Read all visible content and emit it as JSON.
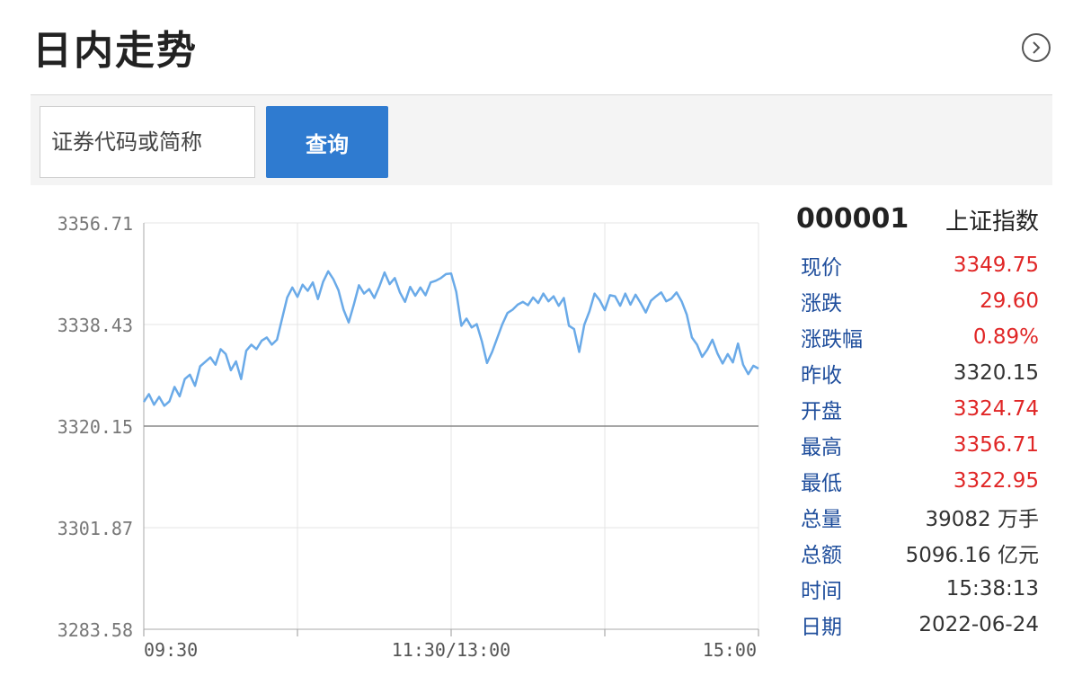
{
  "header": {
    "title": "日内走势",
    "more_icon": "chevron-right-circle-icon"
  },
  "search": {
    "placeholder": "证券代码或简称",
    "button_label": "查询"
  },
  "chart_data": {
    "type": "line",
    "y_ticks": [
      "3356.71",
      "3338.43",
      "3320.15",
      "3301.87",
      "3283.58"
    ],
    "ylim": [
      3283.58,
      3356.71
    ],
    "baseline": 3320.15,
    "x_ticks": [
      "09:30",
      "11:30/13:00",
      "15:00"
    ],
    "x_range": [
      0,
      240
    ],
    "line_color": "#6aaae8",
    "baseline_color": "#888888",
    "series": [
      {
        "values": [
          [
            0,
            3324.5
          ],
          [
            2,
            3325.9
          ],
          [
            4,
            3324.0
          ],
          [
            6,
            3325.4
          ],
          [
            8,
            3323.8
          ],
          [
            10,
            3324.6
          ],
          [
            12,
            3327.2
          ],
          [
            14,
            3325.5
          ],
          [
            16,
            3328.6
          ],
          [
            18,
            3329.4
          ],
          [
            20,
            3327.4
          ],
          [
            22,
            3330.9
          ],
          [
            24,
            3331.7
          ],
          [
            26,
            3332.5
          ],
          [
            28,
            3331.2
          ],
          [
            30,
            3334.0
          ],
          [
            32,
            3333.1
          ],
          [
            34,
            3330.2
          ],
          [
            36,
            3331.8
          ],
          [
            38,
            3328.6
          ],
          [
            40,
            3333.7
          ],
          [
            42,
            3334.8
          ],
          [
            44,
            3334.0
          ],
          [
            46,
            3335.5
          ],
          [
            48,
            3336.1
          ],
          [
            50,
            3334.8
          ],
          [
            52,
            3335.7
          ],
          [
            54,
            3339.5
          ],
          [
            56,
            3343.3
          ],
          [
            58,
            3345.1
          ],
          [
            60,
            3343.4
          ],
          [
            62,
            3345.6
          ],
          [
            64,
            3344.5
          ],
          [
            66,
            3346.0
          ],
          [
            68,
            3343.0
          ],
          [
            70,
            3346.1
          ],
          [
            72,
            3348.0
          ],
          [
            74,
            3346.6
          ],
          [
            76,
            3344.6
          ],
          [
            78,
            3341.1
          ],
          [
            80,
            3338.8
          ],
          [
            82,
            3342.0
          ],
          [
            84,
            3345.5
          ],
          [
            86,
            3344.0
          ],
          [
            88,
            3344.8
          ],
          [
            90,
            3343.2
          ],
          [
            92,
            3345.3
          ],
          [
            94,
            3347.8
          ],
          [
            96,
            3345.7
          ],
          [
            98,
            3346.8
          ],
          [
            100,
            3344.2
          ],
          [
            102,
            3342.5
          ],
          [
            104,
            3345.2
          ],
          [
            106,
            3343.6
          ],
          [
            108,
            3345.1
          ],
          [
            110,
            3343.7
          ],
          [
            112,
            3346.0
          ],
          [
            114,
            3346.3
          ],
          [
            116,
            3346.8
          ],
          [
            118,
            3347.5
          ],
          [
            120,
            3347.6
          ],
          [
            122,
            3344.3
          ],
          [
            124,
            3338.2
          ],
          [
            126,
            3339.5
          ],
          [
            128,
            3337.9
          ],
          [
            130,
            3338.5
          ],
          [
            132,
            3335.4
          ],
          [
            134,
            3331.5
          ],
          [
            136,
            3333.5
          ],
          [
            138,
            3336.0
          ],
          [
            140,
            3338.5
          ],
          [
            142,
            3340.5
          ],
          [
            144,
            3341.1
          ],
          [
            146,
            3342.0
          ],
          [
            148,
            3342.5
          ],
          [
            150,
            3341.9
          ],
          [
            152,
            3343.3
          ],
          [
            154,
            3342.3
          ],
          [
            156,
            3344.0
          ],
          [
            158,
            3342.6
          ],
          [
            160,
            3343.5
          ],
          [
            162,
            3341.8
          ],
          [
            164,
            3343.2
          ],
          [
            166,
            3338.2
          ],
          [
            168,
            3337.6
          ],
          [
            170,
            3333.5
          ],
          [
            172,
            3338.4
          ],
          [
            174,
            3340.8
          ],
          [
            176,
            3344.0
          ],
          [
            178,
            3342.8
          ],
          [
            180,
            3341.0
          ],
          [
            182,
            3343.7
          ],
          [
            184,
            3343.5
          ],
          [
            186,
            3341.8
          ],
          [
            188,
            3344.0
          ],
          [
            190,
            3342.0
          ],
          [
            192,
            3343.8
          ],
          [
            194,
            3342.3
          ],
          [
            196,
            3340.6
          ],
          [
            198,
            3342.7
          ],
          [
            200,
            3343.5
          ],
          [
            202,
            3344.2
          ],
          [
            204,
            3342.6
          ],
          [
            206,
            3343.1
          ],
          [
            208,
            3344.2
          ],
          [
            210,
            3342.6
          ],
          [
            212,
            3340.2
          ],
          [
            214,
            3336.1
          ],
          [
            216,
            3334.8
          ],
          [
            218,
            3332.6
          ],
          [
            220,
            3333.9
          ],
          [
            222,
            3335.7
          ],
          [
            224,
            3333.2
          ],
          [
            226,
            3331.4
          ],
          [
            228,
            3333.1
          ],
          [
            230,
            3331.6
          ],
          [
            232,
            3335.0
          ],
          [
            234,
            3331.2
          ],
          [
            236,
            3329.5
          ],
          [
            238,
            3331.0
          ],
          [
            240,
            3330.5
          ]
        ]
      }
    ]
  },
  "stock": {
    "code": "000001",
    "name": "上证指数"
  },
  "stats": [
    {
      "label": "现价",
      "value": "3349.75",
      "up": true
    },
    {
      "label": "涨跌",
      "value": "29.60",
      "up": true
    },
    {
      "label": "涨跌幅",
      "value": "0.89%",
      "up": true
    },
    {
      "label": "昨收",
      "value": "3320.15",
      "up": false
    },
    {
      "label": "开盘",
      "value": "3324.74",
      "up": true
    },
    {
      "label": "最高",
      "value": "3356.71",
      "up": true
    },
    {
      "label": "最低",
      "value": "3322.95",
      "up": true
    },
    {
      "label": "总量",
      "value": "39082 万手",
      "up": false
    },
    {
      "label": "总额",
      "value": "5096.16 亿元",
      "up": false
    },
    {
      "label": "时间",
      "value": "15:38:13",
      "up": false
    },
    {
      "label": "日期",
      "value": "2022-06-24",
      "up": false
    }
  ]
}
